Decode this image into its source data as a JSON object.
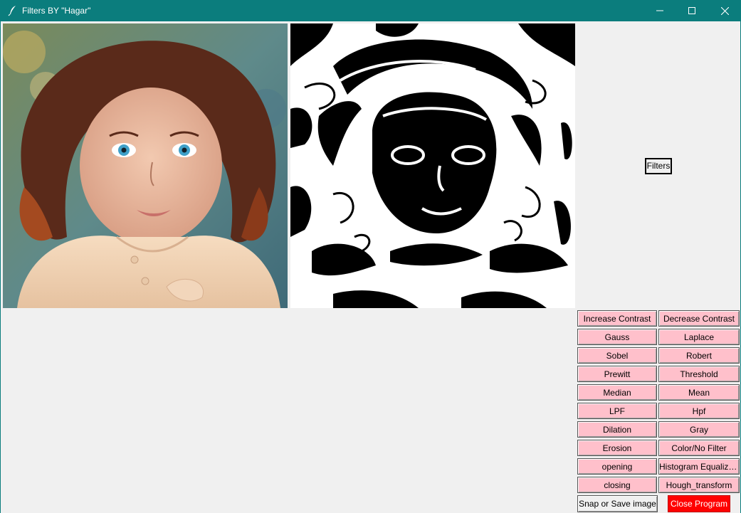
{
  "window": {
    "title": "Filters BY \"Hagar\"",
    "titlebar_color": "#0b7d7d",
    "icons": [
      "feather-icon",
      "minimize-icon",
      "maximize-icon",
      "close-icon"
    ]
  },
  "images": {
    "original": {
      "description_icon": "photo-image"
    },
    "filtered": {
      "description_icon": "threshold-edge-image"
    }
  },
  "filters_label": "Filters",
  "filter_buttons": {
    "color": "#ffc0cb",
    "rows": [
      [
        "Increase Contrast",
        "Decrease Contrast"
      ],
      [
        "Gauss",
        "Laplace"
      ],
      [
        "Sobel",
        "Robert"
      ],
      [
        "Prewitt",
        "Threshold"
      ],
      [
        "Median",
        "Mean"
      ],
      [
        "LPF",
        "Hpf"
      ],
      [
        "Dilation",
        "Gray"
      ],
      [
        "Erosion",
        "Color/No Filter"
      ],
      [
        "opening",
        "Histogram Equalization"
      ],
      [
        "closing",
        "Hough_transform"
      ]
    ]
  },
  "actions": {
    "snap_label": "Snap or Save image",
    "close_label": "Close Program",
    "close_color": "#ff0000"
  }
}
